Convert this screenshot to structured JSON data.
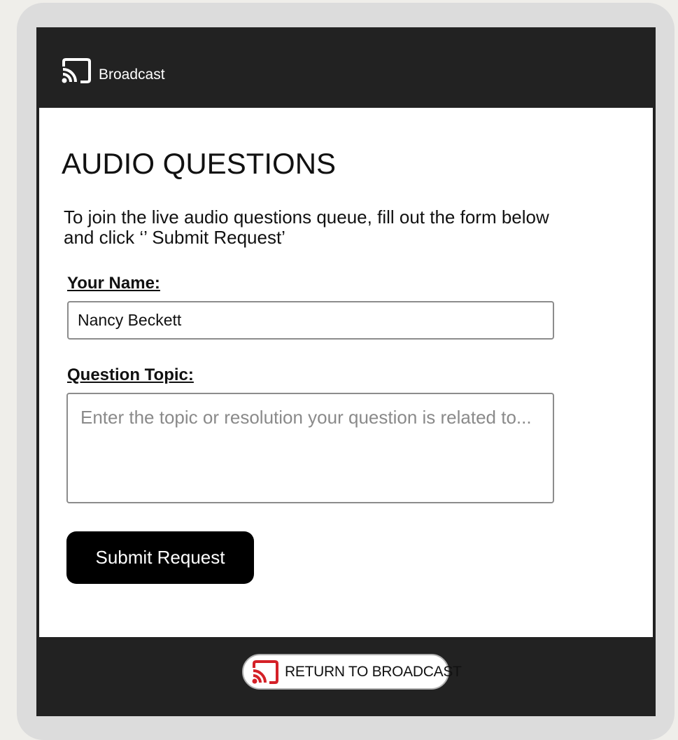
{
  "header": {
    "logo_icon": "cast-icon",
    "title": "Broadcast"
  },
  "main": {
    "title": "AUDIO QUESTIONS",
    "intro": "To join the live audio questions queue, fill out the form below and click ‘’ Submit Request’",
    "name_label": "Your Name:",
    "name_value": "Nancy Beckett",
    "topic_label": "Question Topic:",
    "topic_placeholder": "Enter the topic or resolution your question is related to...",
    "submit_label": "Submit Request"
  },
  "footer": {
    "return_icon": "cast-icon",
    "return_label": "RETURN TO BROADCAST"
  },
  "colors": {
    "header_bg": "#222222",
    "button_bg": "#000000",
    "return_icon": "#d42027"
  }
}
